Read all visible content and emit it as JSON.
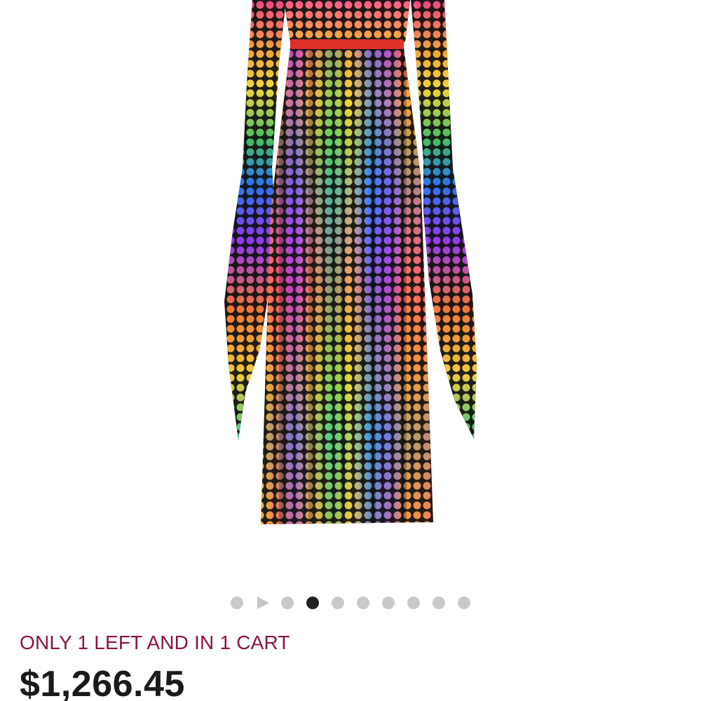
{
  "product": {
    "image_icon": "dress-photo",
    "image_alt": "Multicolor polka dot maxi dress with handkerchief sleeves"
  },
  "carousel": {
    "total": 10,
    "active_index": 3,
    "video_index": 1
  },
  "stock": {
    "text": "ONLY 1 LEFT AND IN 1 CART",
    "color": "#8a1538"
  },
  "price": {
    "text": "$1,266.45"
  }
}
